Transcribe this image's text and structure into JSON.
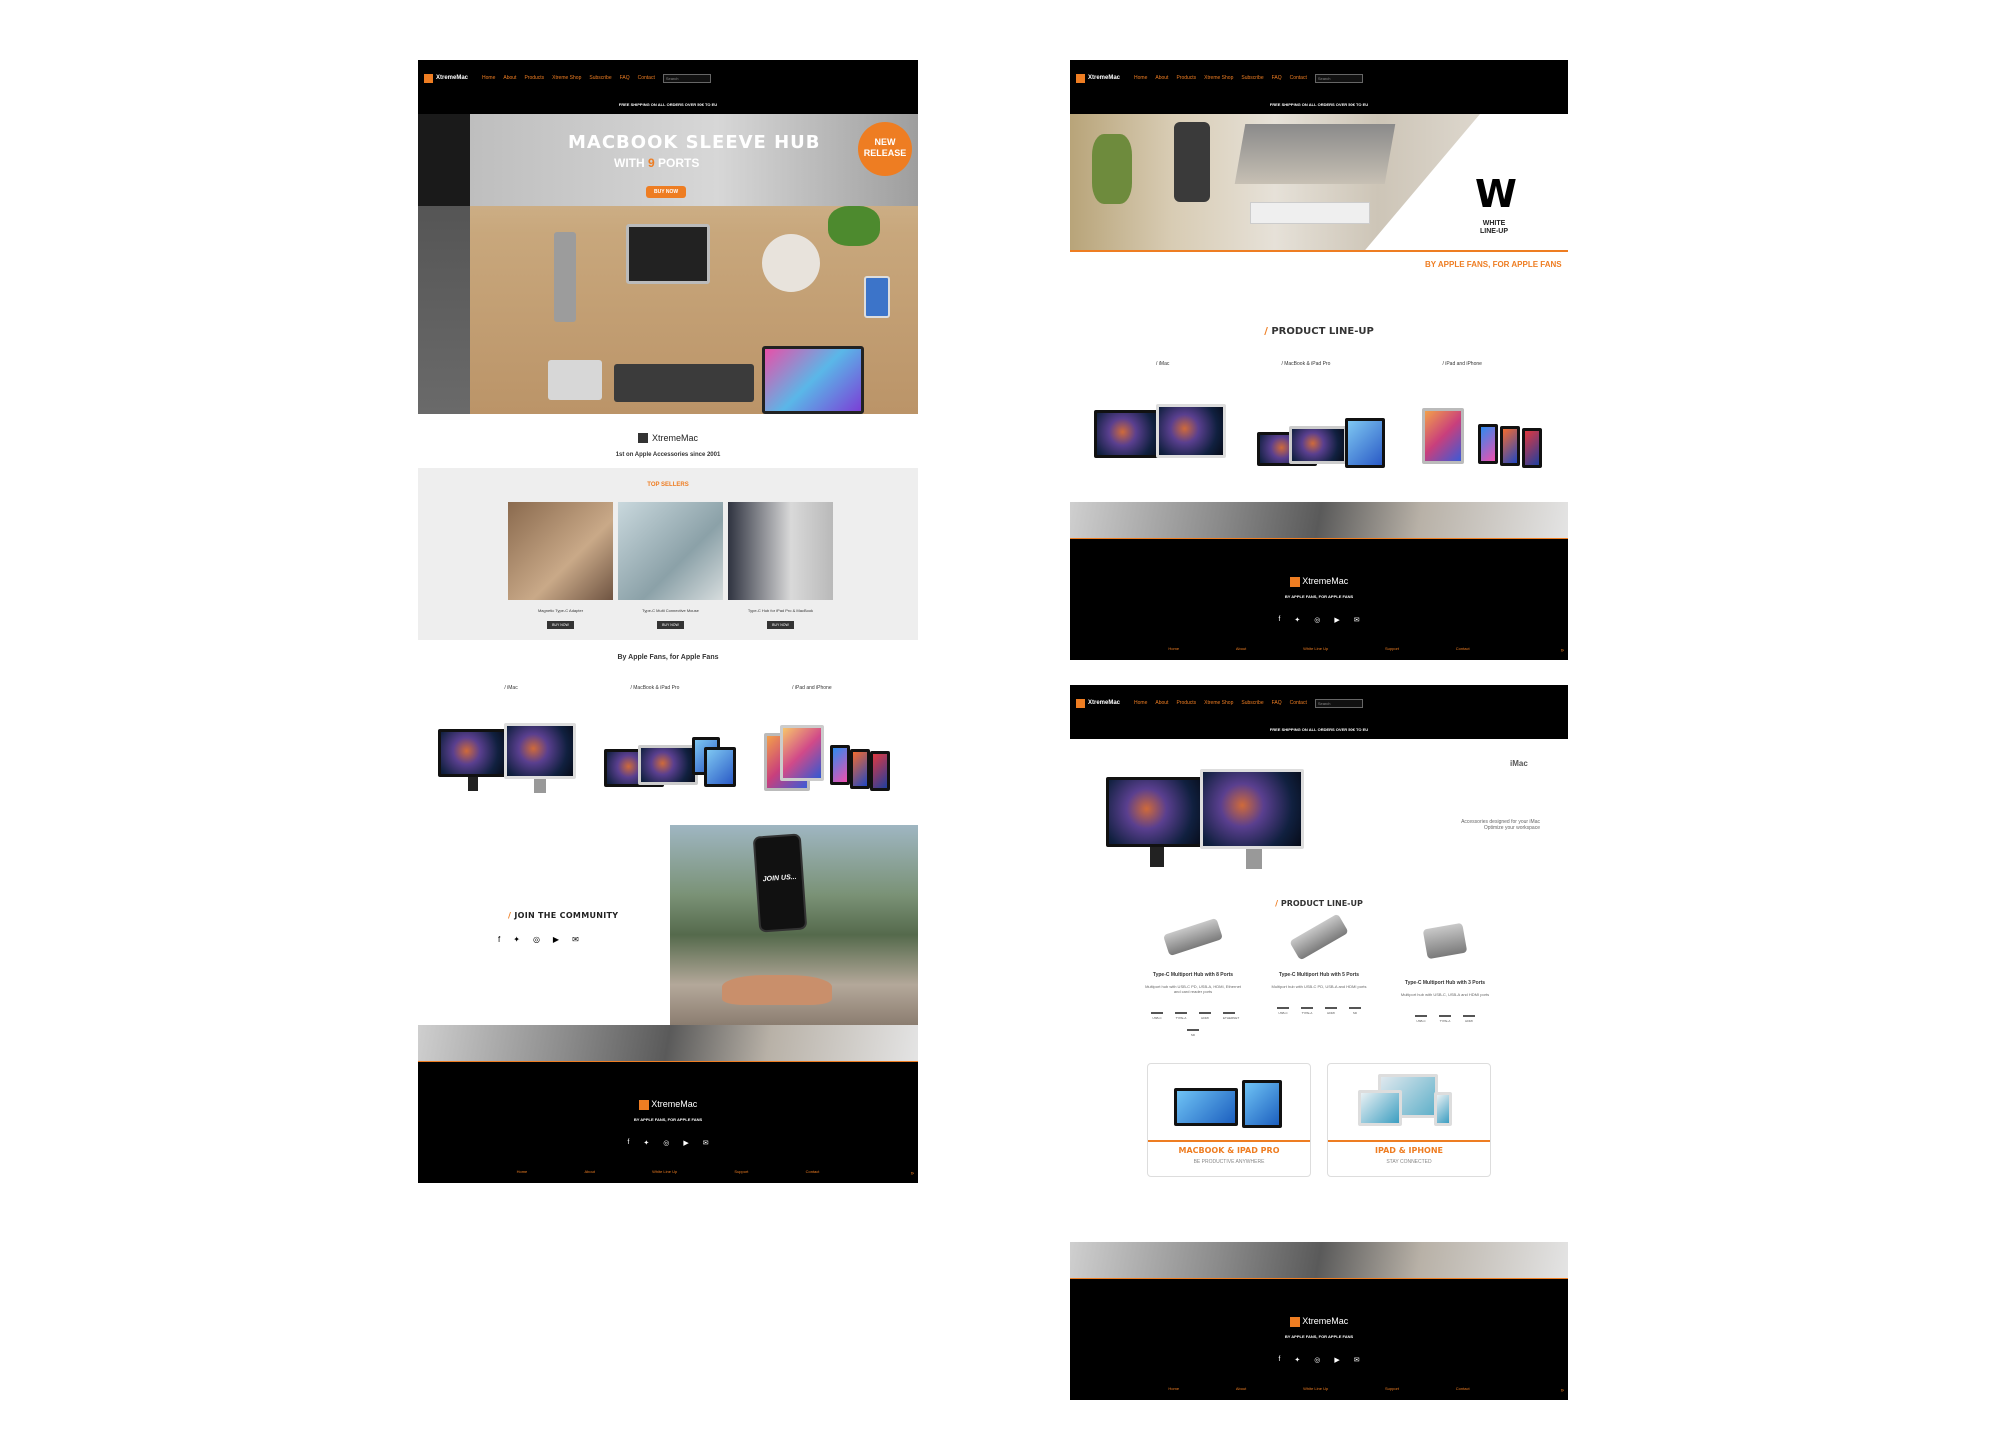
{
  "nav": {
    "logo": "XtremeMac",
    "items": [
      "Home",
      "About",
      "Products",
      "Xtreme Shop",
      "Subscribe",
      "FAQ",
      "Contact"
    ],
    "search_placeholder": "Search",
    "shipping": "FREE SHIPPING ON ALL ORDERS OVER 50€ TO EU"
  },
  "hero": {
    "title": "MACBOOK SLEEVE HUB",
    "sub_prefix": "WITH ",
    "sub_number": "9",
    "sub_suffix": " PORTS",
    "button": "BUY NOW",
    "badge_line1": "NEW",
    "badge_line2": "RELEASE"
  },
  "brand": {
    "name": "XtremeMac",
    "tagline": "1st on Apple Accessories since 2001"
  },
  "top_sellers": {
    "title": "TOP SELLERS",
    "items": [
      {
        "name": "Magnetic Type-C Adapter",
        "button": "BUY NOW"
      },
      {
        "name": "Type-C Multi Connective Mouse",
        "button": "BUY NOW"
      },
      {
        "name": "Type-C Hub for iPad Pro & MacBook",
        "button": "BUY NOW"
      }
    ]
  },
  "slogan": "By Apple Fans, for Apple Fans",
  "lineup": {
    "title_slash": "/",
    "title": " PRODUCT LINE-UP",
    "labels": [
      "/ iMac",
      "/ MacBook & iPad Pro",
      "/ iPad and iPhone"
    ]
  },
  "community": {
    "slash": "/",
    "title": " JOIN THE COMMUNITY",
    "phone_text": "JOIN US..."
  },
  "social_icons": [
    "facebook-icon",
    "twitter-icon",
    "instagram-icon",
    "youtube-icon",
    "mail-icon"
  ],
  "footer": {
    "logo": "XtremeMac",
    "tagline": "BY APPLE FANS, FOR APPLE FANS",
    "links": [
      "Home",
      "About",
      "White Line Up",
      "Support",
      "Contact"
    ],
    "scroll_top": "»"
  },
  "white_lineup": {
    "big_letter": "W",
    "line1": "WHITE",
    "line2": "LINE-UP",
    "slogan": "BY APPLE FANS, FOR APPLE FANS"
  },
  "imac_page": {
    "title": "iMac",
    "desc_line1": "Accessories designed for your iMac",
    "desc_line2": "Optimize your workspace",
    "hubs": [
      {
        "name": "Type-C Multiport Hub with 8 Ports",
        "desc": "Multiport hub with USB-C PD, USB-A, HDMI, Ethernet and card reader ports",
        "ports": [
          "USB-C",
          "TYPE-A",
          "HDMI",
          "ETHERNET",
          "SD"
        ]
      },
      {
        "name": "Type-C Multiport Hub with 5 Ports",
        "desc": "Multiport hub with USB-C PD, USB-A and HDMI ports",
        "ports": [
          "USB-C",
          "TYPE-A",
          "HDMI",
          "SD"
        ]
      },
      {
        "name": "Type-C Multiport Hub with 3 Ports",
        "desc": "Multiport hub with USB-C, USB-A and HDMI ports",
        "ports": [
          "USB-C",
          "TYPE-A",
          "HDMI"
        ]
      }
    ],
    "categories": [
      {
        "title": "MACBOOK & IPAD PRO",
        "sub": "BE PRODUCTIVE ANYWHERE"
      },
      {
        "title": "IPAD & IPHONE",
        "sub": "STAY CONNECTED"
      }
    ]
  },
  "colors": {
    "accent": "#ee7d22",
    "black": "#000000",
    "panel": "#eeeeee"
  }
}
